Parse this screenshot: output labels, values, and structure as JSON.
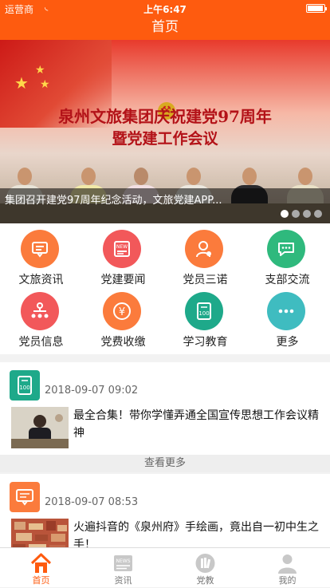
{
  "status": {
    "carrier": "运营商",
    "time": "上午6:47"
  },
  "nav": {
    "title": "首页"
  },
  "banner": {
    "headline1": "泉州文旅集团庆祝建党97周年",
    "headline2": "暨党建工作会议",
    "caption": "集团召开建党97周年纪念活动，文旅党建APP..."
  },
  "grid": [
    {
      "label": "文旅资讯",
      "color": "#fb7b3c",
      "icon": "chat-screen-icon"
    },
    {
      "label": "党建要闻",
      "color": "#f2585a",
      "icon": "news-icon"
    },
    {
      "label": "党员三诺",
      "color": "#fb7b3c",
      "icon": "person-icon"
    },
    {
      "label": "支部交流",
      "color": "#2fb97d",
      "icon": "chat-bubble-icon"
    },
    {
      "label": "党员信息",
      "color": "#f2585a",
      "icon": "org-chart-icon"
    },
    {
      "label": "党费收缴",
      "color": "#fb7b3c",
      "icon": "yen-icon"
    },
    {
      "label": "学习教育",
      "color": "#1ea98a",
      "icon": "book-100-icon"
    },
    {
      "label": "更多",
      "color": "#3fbcc0",
      "icon": "more-icon"
    }
  ],
  "news": [
    {
      "date": "2018-09-07 09:02",
      "title": "最全合集！带你学懂弄通全国宣传思想工作会议精神",
      "tag_color": "#1ea98a",
      "tag_icon": "book-100-icon"
    },
    {
      "date": "2018-09-07 08:53",
      "title": "火遍抖音的《泉州府》手绘画，竟出自一初中生之手！",
      "tag_color": "#fb7b3c",
      "tag_icon": "chat-screen-icon"
    }
  ],
  "more_label": "查看更多",
  "tabs": [
    {
      "label": "首页",
      "active": true
    },
    {
      "label": "资讯",
      "active": false
    },
    {
      "label": "党教",
      "active": false
    },
    {
      "label": "我的",
      "active": false
    }
  ]
}
